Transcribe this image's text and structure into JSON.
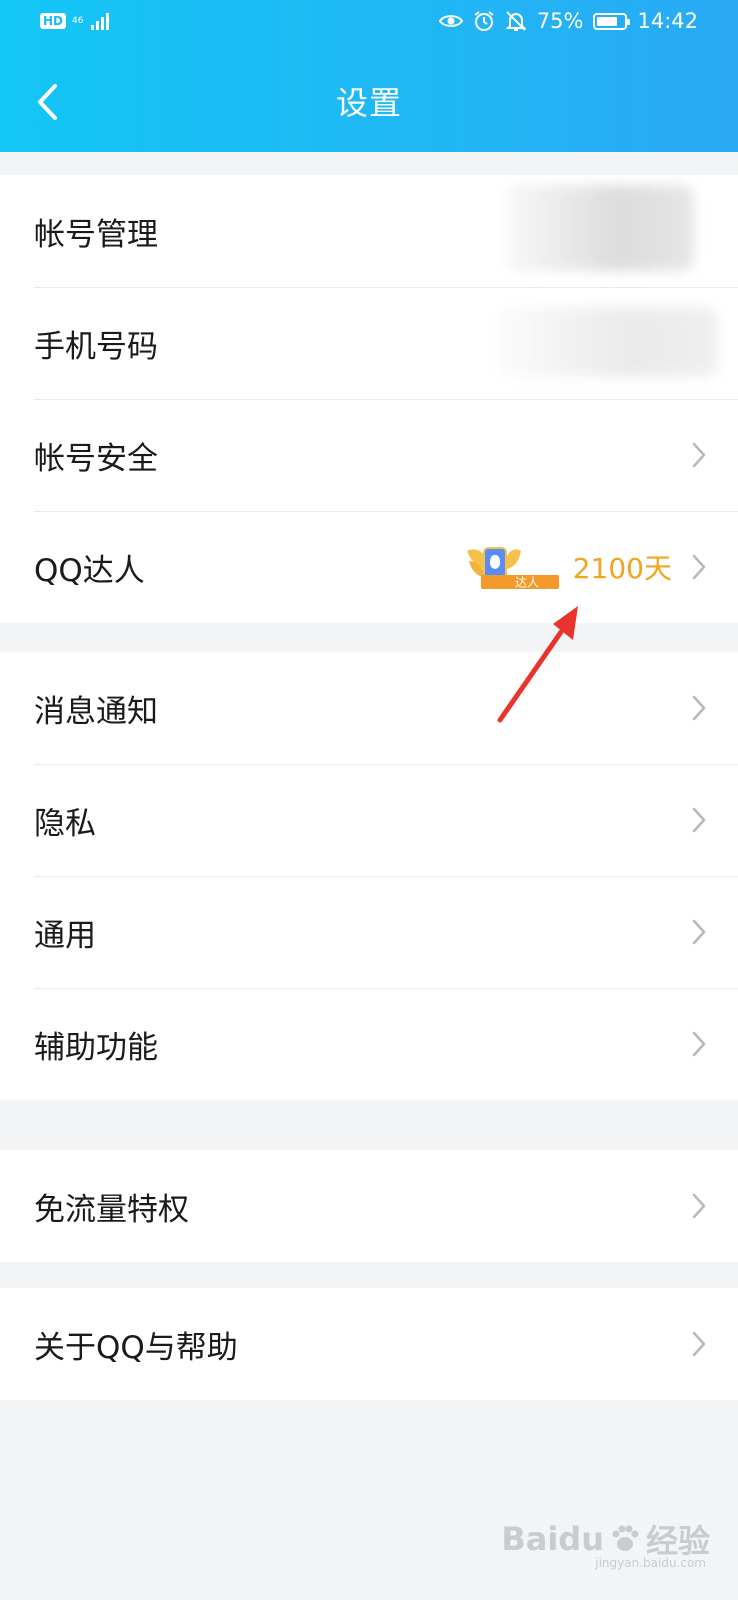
{
  "status_bar": {
    "hd": "HD",
    "network": "46",
    "battery": "75%",
    "battery_level": 0.75,
    "time": "14:42"
  },
  "header": {
    "title": "设置",
    "back_icon": "chevron-left-icon"
  },
  "groups": [
    {
      "rows": [
        {
          "label": "帐号管理",
          "right": "blurred-avatar"
        },
        {
          "label": "手机号码",
          "right": "blurred-text"
        },
        {
          "label": "帐号安全",
          "right": "chevron"
        },
        {
          "label": "QQ达人",
          "right": "talent",
          "badge_text": "达人",
          "days": "2100天"
        }
      ]
    },
    {
      "rows": [
        {
          "label": "消息通知"
        },
        {
          "label": "隐私"
        },
        {
          "label": "通用"
        },
        {
          "label": "辅助功能"
        }
      ]
    },
    {
      "rows": [
        {
          "label": "免流量特权"
        }
      ]
    },
    {
      "rows": [
        {
          "label": "关于QQ与帮助"
        }
      ]
    }
  ],
  "annotation": {
    "color": "#e8342c",
    "icon": "red-arrow-annotation"
  },
  "watermark": {
    "brand": "Baidu",
    "suffix": "经验",
    "url": "jingyan.baidu.com"
  },
  "colors": {
    "header_start": "#13c6f6",
    "header_end": "#2aa9f5",
    "talent": "#f0a51c",
    "background": "#f2f4f6"
  }
}
